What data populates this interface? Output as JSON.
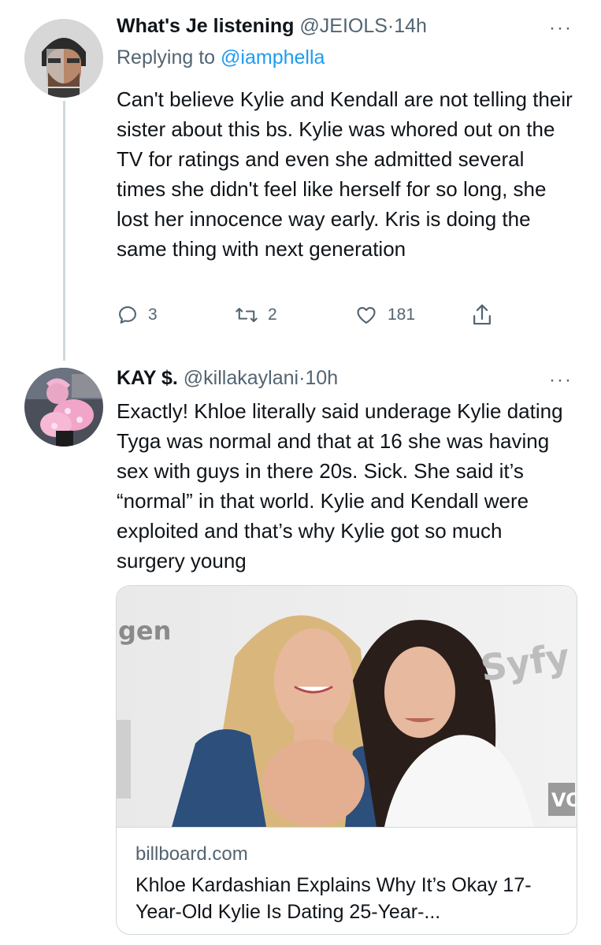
{
  "tweets": [
    {
      "display_name": "What's Je listening",
      "handle": "@JEIOLS",
      "separator": "·",
      "time": "14h",
      "reply_prefix": "Replying to ",
      "reply_to": "@iamphella",
      "text": "Can't believe Kylie and Kendall are not telling their sister about this bs. Kylie was whored out on the TV for ratings and even she admitted several times she didn't feel like herself for so long, she lost her innocence way early. Kris is doing the same thing with next generation",
      "replies": "3",
      "retweets": "2",
      "likes": "181",
      "more_label": "···"
    },
    {
      "display_name": "KAY $.",
      "handle": "@killakaylani",
      "separator": "·",
      "time": "10h",
      "text": "Exactly! Khloe literally said underage Kylie dating Tyga was normal and that at 16 she was having sex with guys in there 20s. Sick. She said it’s “normal” in that world. Kylie and Kendall were exploited and that’s why Kylie got so much surgery young",
      "more_label": "···",
      "link_card": {
        "domain": "billboard.com",
        "title": "Khloe Kardashian Explains Why It’s Okay 17-Year-Old Kylie Is Dating 25-Year-...",
        "backdrop_text_left": "gen",
        "backdrop_text_right": "Syfy",
        "backdrop_text_corner": "VO"
      }
    }
  ],
  "icons": [
    "reply-icon",
    "retweet-icon",
    "like-icon",
    "share-icon",
    "more-icon"
  ],
  "colors": {
    "link": "#1d9bf0",
    "muted": "#536471",
    "text": "#0f1419",
    "border": "#cfd9de"
  }
}
